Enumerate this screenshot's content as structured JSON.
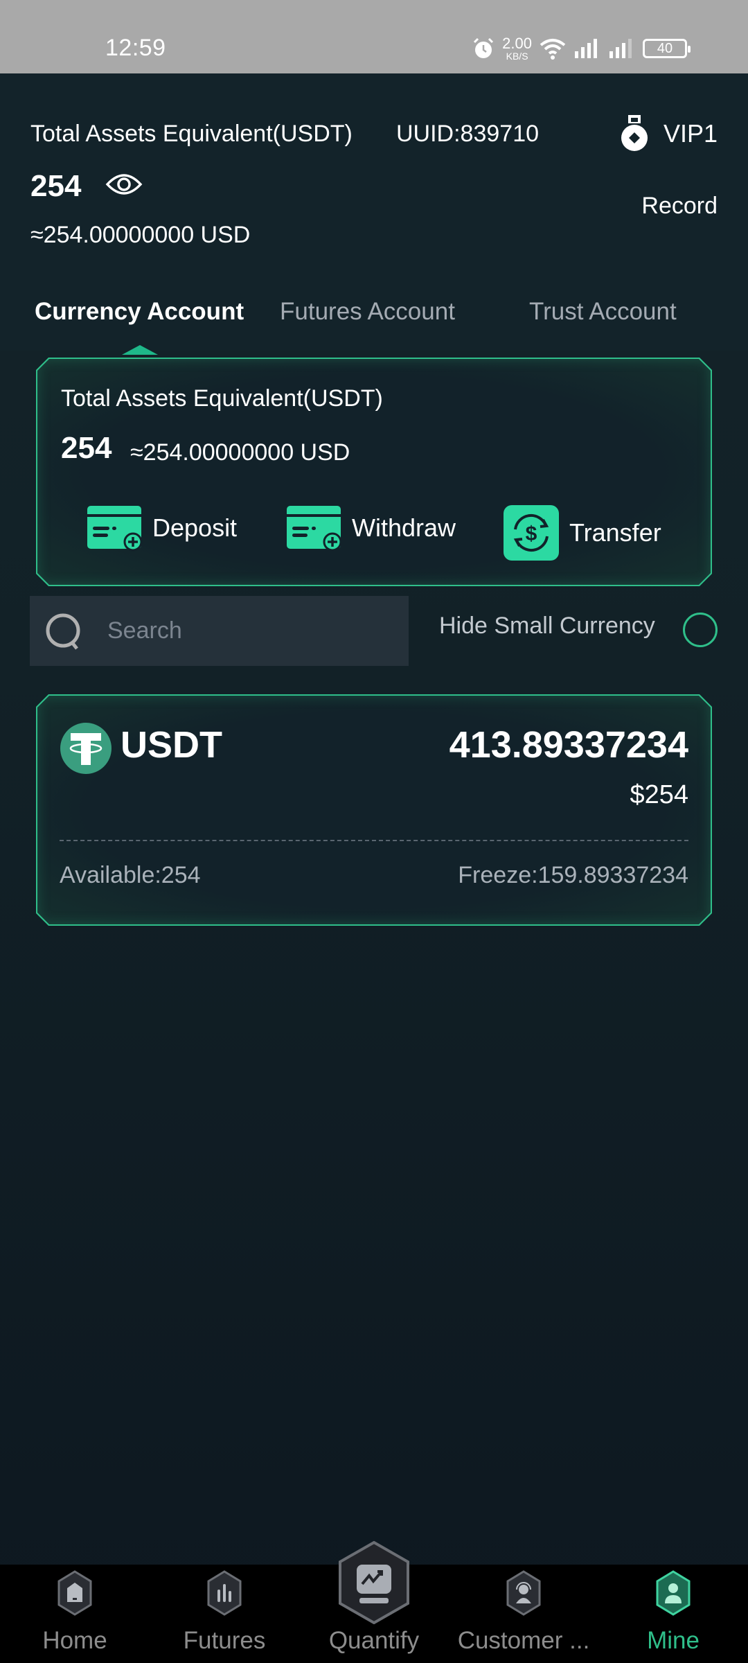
{
  "status_bar": {
    "time": "12:59",
    "net_speed_value": "2.00",
    "net_speed_unit": "KB/S",
    "battery": "40",
    "icons": [
      "alarm-icon",
      "wifi-icon",
      "signal-icon",
      "signal-icon"
    ]
  },
  "header": {
    "title": "Total Assets Equivalent(USDT)",
    "uuid": "UUID:839710",
    "vip_level": "VIP1",
    "amount": "254",
    "usd_equivalent": "≈254.00000000 USD",
    "record_label": "Record"
  },
  "tabs": [
    {
      "label": "Currency Account",
      "active": true
    },
    {
      "label": "Futures Account",
      "active": false
    },
    {
      "label": "Trust Account",
      "active": false
    }
  ],
  "assets_card": {
    "title": "Total Assets Equivalent(USDT)",
    "amount": "254",
    "usd_equivalent": "≈254.00000000 USD",
    "actions": [
      {
        "label": "Deposit",
        "icon": "deposit-card-icon"
      },
      {
        "label": "Withdraw",
        "icon": "withdraw-card-icon"
      },
      {
        "label": "Transfer",
        "icon": "transfer-dollar-icon"
      }
    ]
  },
  "search": {
    "placeholder": "Search",
    "value": ""
  },
  "hide_small": {
    "label": "Hide Small Currency",
    "checked": false
  },
  "coins": [
    {
      "symbol": "USDT",
      "total": "413.89337234",
      "usd_value": "$254",
      "available": "Available:254",
      "freeze": "Freeze:159.89337234"
    }
  ],
  "bottom_nav": [
    {
      "label": "Home",
      "active": false
    },
    {
      "label": "Futures",
      "active": false
    },
    {
      "label": "Quantify",
      "active": false
    },
    {
      "label": "Customer ...",
      "active": false
    },
    {
      "label": "Mine",
      "active": true
    }
  ],
  "colors": {
    "accent": "#2fbf8a",
    "background": "#122127",
    "tether": "#3a9e7f"
  }
}
